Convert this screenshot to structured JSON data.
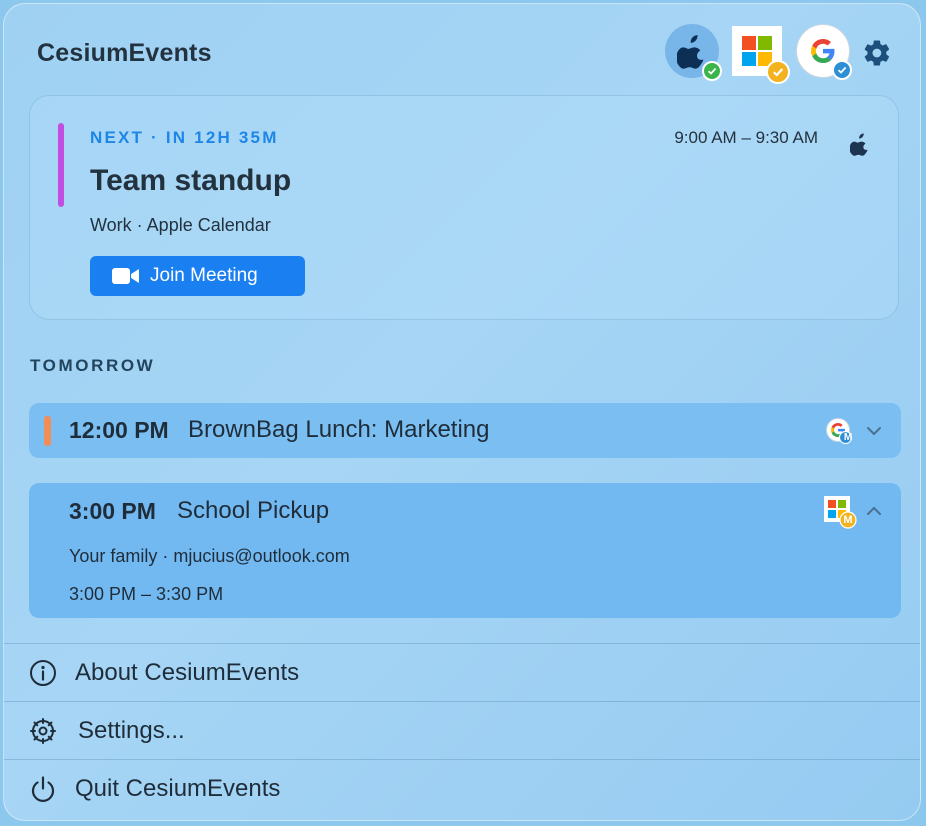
{
  "app": {
    "title": "CesiumEvents"
  },
  "accounts": [
    {
      "name": "apple",
      "status": "connected"
    },
    {
      "name": "microsoft",
      "status": "connected"
    },
    {
      "name": "google",
      "status": "connected"
    }
  ],
  "next_event": {
    "label": "NEXT · IN 12H 35M",
    "time_range": "9:00 AM – 9:30 AM",
    "title": "Team standup",
    "subtitle": "Work · Apple Calendar",
    "join_label": "Join Meeting",
    "color": "#c24ee0"
  },
  "section": {
    "title": "TOMORROW"
  },
  "events": [
    {
      "time": "12:00 PM",
      "title": "BrownBag Lunch: Marketing",
      "source": "google",
      "badge": "M",
      "color": "#f28d57",
      "expanded": false
    },
    {
      "time": "3:00 PM",
      "title": "School Pickup",
      "source": "microsoft",
      "badge": "M",
      "detail": "Your family · mjucius@outlook.com",
      "time_range": "3:00 PM – 3:30 PM",
      "expanded": true
    }
  ],
  "menu": {
    "about": "About CesiumEvents",
    "settings": "Settings...",
    "quit": "Quit CesiumEvents"
  },
  "colors": {
    "accent": "#1a7ff0",
    "text": "#23323f",
    "badge_green": "#3bb54a",
    "badge_yellow": "#f2b31f",
    "badge_blue": "#2d8fd6"
  }
}
